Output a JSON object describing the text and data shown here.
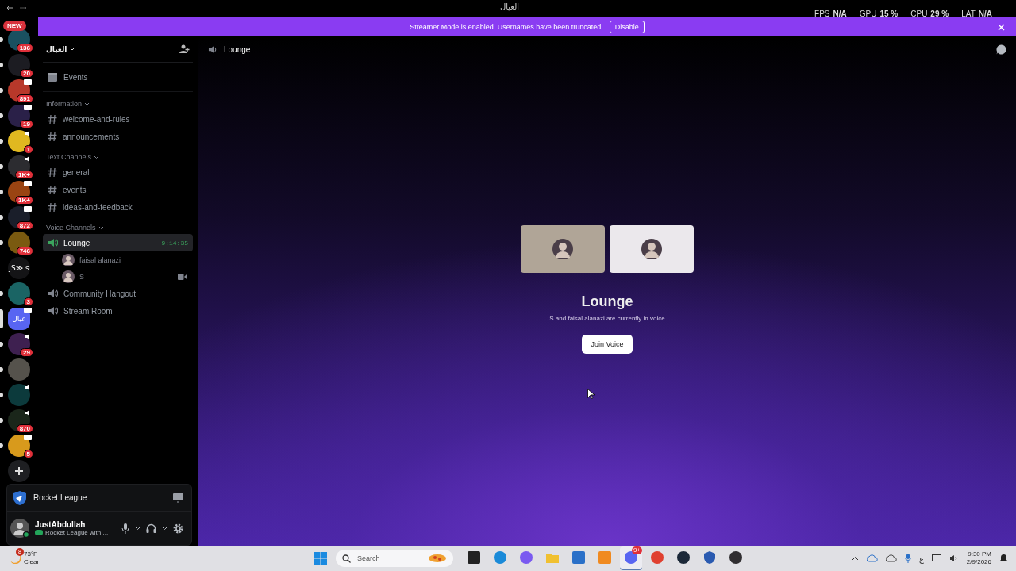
{
  "titlebar": {
    "title": "العيال"
  },
  "overlay_stats": [
    {
      "label": "FPS",
      "value": "N/A"
    },
    {
      "label": "GPU",
      "value": "15 %"
    },
    {
      "label": "CPU",
      "value": "29 %"
    },
    {
      "label": "LAT",
      "value": "N/A"
    }
  ],
  "servers": [
    {
      "tag": "NEW",
      "badge": "136",
      "unread": true,
      "selected": false,
      "color": "#1a5060",
      "voice": false,
      "screen": false
    },
    {
      "badge": "20",
      "unread": true,
      "selected": false,
      "color": "#1c1c22",
      "voice": false,
      "screen": false
    },
    {
      "badge": "891",
      "unread": true,
      "selected": false,
      "color": "#b8382a",
      "voice": false,
      "screen": true
    },
    {
      "badge": "19",
      "unread": true,
      "selected": false,
      "color": "#2a2048",
      "voice": false,
      "screen": true
    },
    {
      "badge": "1",
      "unread": true,
      "selected": false,
      "color": "#e0b820",
      "voice": true,
      "screen": false
    },
    {
      "badge": "1K+",
      "unread": true,
      "selected": false,
      "color": "#2c2c30",
      "voice": true,
      "screen": false
    },
    {
      "badge": "1K+",
      "unread": true,
      "selected": false,
      "color": "#9a4412",
      "voice": false,
      "screen": true
    },
    {
      "badge": "872",
      "unread": true,
      "selected": false,
      "color": "#1a1e2a",
      "voice": false,
      "screen": true
    },
    {
      "badge": "746",
      "unread": true,
      "selected": false,
      "color": "#7a5a10",
      "voice": false,
      "screen": false
    },
    {
      "label": "JS≫.s",
      "unread": false,
      "selected": false,
      "color": "#141416",
      "voice": false,
      "screen": false
    },
    {
      "badge": "3",
      "unread": true,
      "selected": false,
      "color": "#1a6464",
      "voice": false,
      "screen": false
    },
    {
      "label": "عيال",
      "unread": false,
      "selected": true,
      "color": "#5865f2",
      "voice": false,
      "screen": true
    },
    {
      "badge": "29",
      "unread": true,
      "selected": false,
      "color": "#3e2050",
      "voice": true,
      "screen": false
    },
    {
      "unread": true,
      "selected": false,
      "color": "#55524c",
      "voice": false,
      "screen": false
    },
    {
      "unread": true,
      "selected": false,
      "color": "#0c3a3c",
      "voice": true,
      "screen": false
    },
    {
      "badge": "870",
      "unread": true,
      "selected": false,
      "color": "#1a261a",
      "voice": true,
      "screen": false
    },
    {
      "badge": "5",
      "unread": true,
      "selected": false,
      "color": "#d89a1c",
      "voice": false,
      "screen": true
    }
  ],
  "banner": {
    "text": "Streamer Mode is enabled. Usernames have been truncated.",
    "button": "Disable"
  },
  "server": {
    "name": "العيال"
  },
  "sidebar": {
    "events": "Events",
    "categories": [
      {
        "name": "Information",
        "channels": [
          {
            "kind": "text",
            "name": "welcome-and-rules",
            "selected": false
          },
          {
            "kind": "text",
            "name": "announcements",
            "selected": false
          }
        ]
      },
      {
        "name": "Text Channels",
        "channels": [
          {
            "kind": "text",
            "name": "general",
            "selected": false
          },
          {
            "kind": "text",
            "name": "events",
            "selected": false
          },
          {
            "kind": "text",
            "name": "ideas-and-feedback",
            "selected": false
          }
        ]
      },
      {
        "name": "Voice Channels",
        "channels": [
          {
            "kind": "voice",
            "name": "Lounge",
            "selected": true,
            "timer": "9:14:35",
            "members": [
              {
                "kind": "audio",
                "name": "faisal alanazi"
              },
              {
                "kind": "video",
                "name": "S"
              }
            ]
          },
          {
            "kind": "voice",
            "name": "Community Hangout",
            "selected": false
          },
          {
            "kind": "voice",
            "name": "Stream Room",
            "selected": false
          }
        ]
      }
    ]
  },
  "activity": {
    "game": "Rocket League"
  },
  "user": {
    "name": "JustAbdullah",
    "status": "Rocket League with ..."
  },
  "channel_header": {
    "name": "Lounge"
  },
  "voice_preview": {
    "tiles": [
      {
        "color": "#b0a597"
      },
      {
        "color": "#ebe8ec"
      }
    ],
    "title": "Lounge",
    "subtitle": "S and faisal alanazi are currently in voice",
    "button": "Join Voice"
  },
  "taskbar": {
    "weather": {
      "badge": "8",
      "temp": "73°F",
      "condition": "Clear"
    },
    "search": {
      "placeholder": "Search"
    },
    "apps": [
      {
        "kind": "taskview",
        "active": false
      },
      {
        "kind": "edge",
        "active": false
      },
      {
        "kind": "copilot",
        "active": false
      },
      {
        "kind": "explorer",
        "active": false
      },
      {
        "kind": "store",
        "active": false
      },
      {
        "kind": "orange",
        "active": false
      },
      {
        "kind": "discord",
        "active": true,
        "badge": "9+"
      },
      {
        "kind": "chrome",
        "active": false
      },
      {
        "kind": "steam",
        "active": false
      },
      {
        "kind": "shield",
        "active": false
      },
      {
        "kind": "obs",
        "active": false
      }
    ],
    "language": "ع",
    "time": "9:30 PM",
    "date": "2/9/2026"
  }
}
